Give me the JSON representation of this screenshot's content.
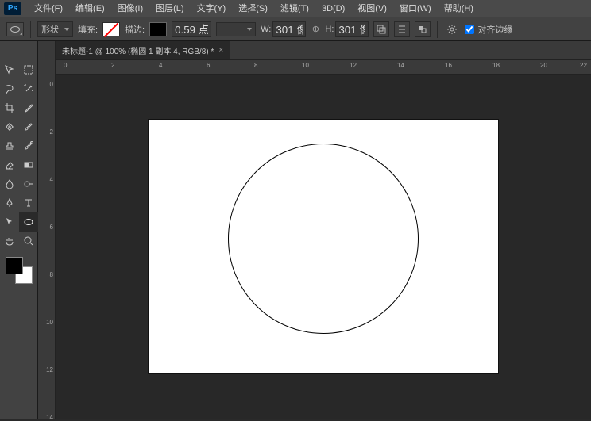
{
  "menubar": {
    "items": [
      {
        "label": "文件(F)"
      },
      {
        "label": "编辑(E)"
      },
      {
        "label": "图像(I)"
      },
      {
        "label": "图层(L)"
      },
      {
        "label": "文字(Y)"
      },
      {
        "label": "选择(S)"
      },
      {
        "label": "滤镜(T)"
      },
      {
        "label": "3D(D)"
      },
      {
        "label": "视图(V)"
      },
      {
        "label": "窗口(W)"
      },
      {
        "label": "帮助(H)"
      }
    ]
  },
  "optbar": {
    "shape_dropdown": "形状",
    "fill_label": "填充:",
    "stroke_label": "描边:",
    "stroke_width": "0.59 点",
    "w_label": "W:",
    "w_value": "301 像",
    "h_label": "H:",
    "h_value": "301 像",
    "align_edges": "对齐边缘"
  },
  "doctab": {
    "title": "未标题-1 @ 100% (椭圆 1 副本 4, RGB/8) *"
  },
  "top_ruler": [
    "0",
    "2",
    "4",
    "6",
    "8",
    "10",
    "12",
    "14",
    "16",
    "18",
    "20",
    "22"
  ],
  "left_ruler": [
    "0",
    "2",
    "4",
    "6",
    "8",
    "10",
    "12",
    "14"
  ]
}
